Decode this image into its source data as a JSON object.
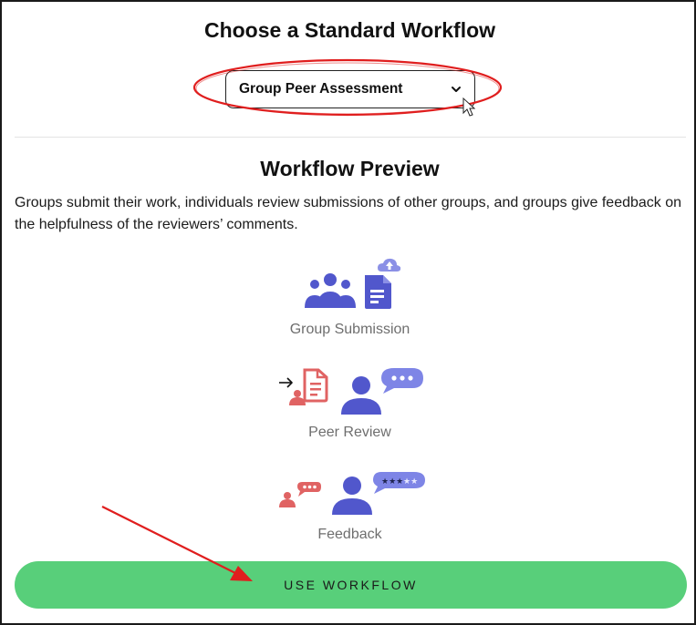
{
  "dialog": {
    "title": "Choose a Standard Workflow",
    "workflow_select": {
      "selected": "Group Peer Assessment",
      "icon": "chevron-down-icon"
    },
    "preview_title": "Workflow Preview",
    "description": "Groups submit their work, individuals review submissions of other groups, and groups give feedback on the helpfulness of the reviewers’ comments.",
    "steps": [
      {
        "label": "Group Submission",
        "icon": "group-submission-icon"
      },
      {
        "label": "Peer Review",
        "icon": "peer-review-icon"
      },
      {
        "label": "Feedback",
        "icon": "feedback-icon"
      }
    ],
    "use_button": {
      "label": "USE WORKFLOW"
    }
  },
  "colors": {
    "primary_icon": "#5157cc",
    "light_icon": "#7e85e6",
    "red_icon": "#e06363",
    "button_green": "#58cf7a",
    "annotation_red": "#e01e1e"
  }
}
